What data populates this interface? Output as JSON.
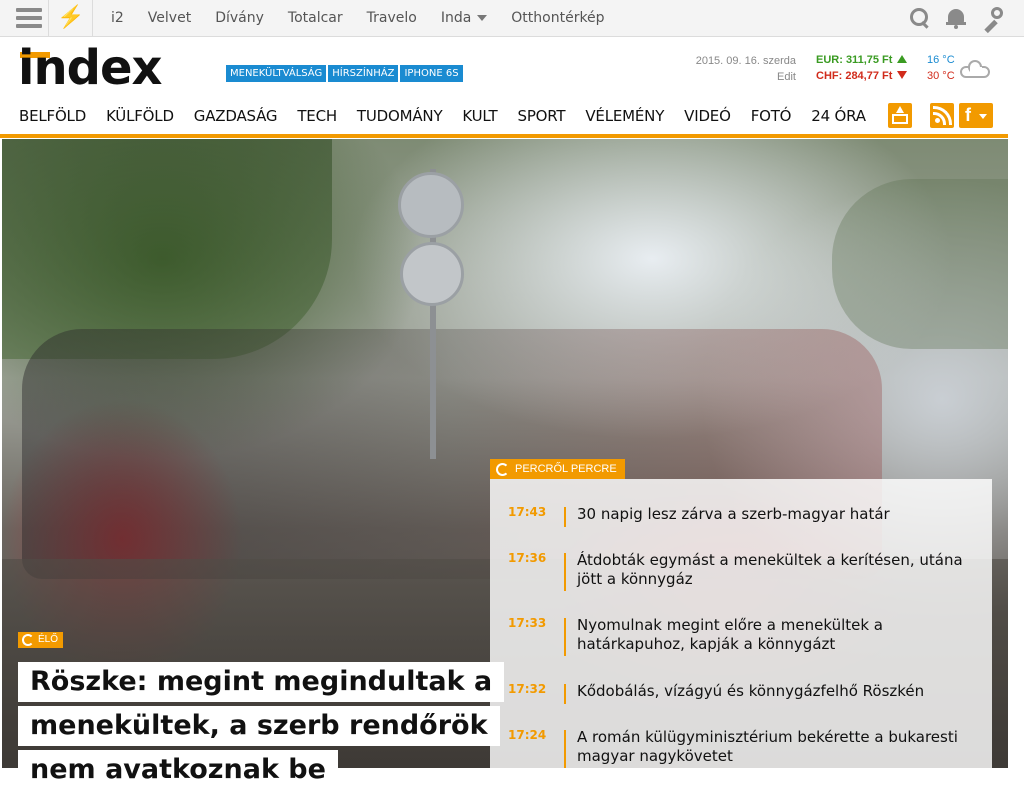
{
  "topbar": {
    "links": [
      "i2",
      "Velvet",
      "Dívány",
      "Totalcar",
      "Travelo",
      "Inda",
      "Otthontérkép"
    ]
  },
  "header": {
    "logo": "index",
    "tags": [
      "MENEKÜLTVÁLSÁG",
      "HÍRSZÍNHÁZ",
      "IPHONE 6S"
    ],
    "date": "2015. 09. 16. szerda",
    "edit": "Edit",
    "currency": {
      "eur": "EUR: 311,75 Ft",
      "chf": "CHF: 284,77 Ft",
      "eur_trend": "up",
      "chf_trend": "down"
    },
    "weather": {
      "low": "16 °C",
      "high": "30 °C",
      "icon": "cloud-icon"
    }
  },
  "nav": {
    "items": [
      "BELFÖLD",
      "KÜLFÖLD",
      "GAZDASÁG",
      "TECH",
      "TUDOMÁNY",
      "KULT",
      "SPORT",
      "VÉLEMÉNY",
      "VIDEÓ",
      "FOTÓ",
      "24 ÓRA"
    ],
    "fb_label": "f"
  },
  "hero": {
    "live_label": "ÉLŐ",
    "headline_lines": [
      "Röszke: megint megindultak a",
      "menekültek, a szerb rendőrök",
      "nem avatkoznak be"
    ]
  },
  "live": {
    "label": "PERCRŐL PERCRE",
    "items": [
      {
        "time": "17:43",
        "text": "30 napig lesz zárva a szerb-magyar határ"
      },
      {
        "time": "17:36",
        "text": "Átdobták egymást a menekültek a kerítésen, utána jött a könnygáz"
      },
      {
        "time": "17:33",
        "text": "Nyomulnak megint előre a menekültek a határkapuhoz, kapják a könnygázt"
      },
      {
        "time": "17:32",
        "text": "Kődobálás, vízágyú és könnygázfelhő Röszkén"
      },
      {
        "time": "17:24",
        "text": "A román külügyminisztérium bekérette a bukaresti magyar nagykövetet"
      }
    ]
  },
  "colors": {
    "accent": "#f29a00",
    "tag_blue": "#1a8bd1",
    "up": "#3a9b22",
    "down": "#d12b1b"
  }
}
